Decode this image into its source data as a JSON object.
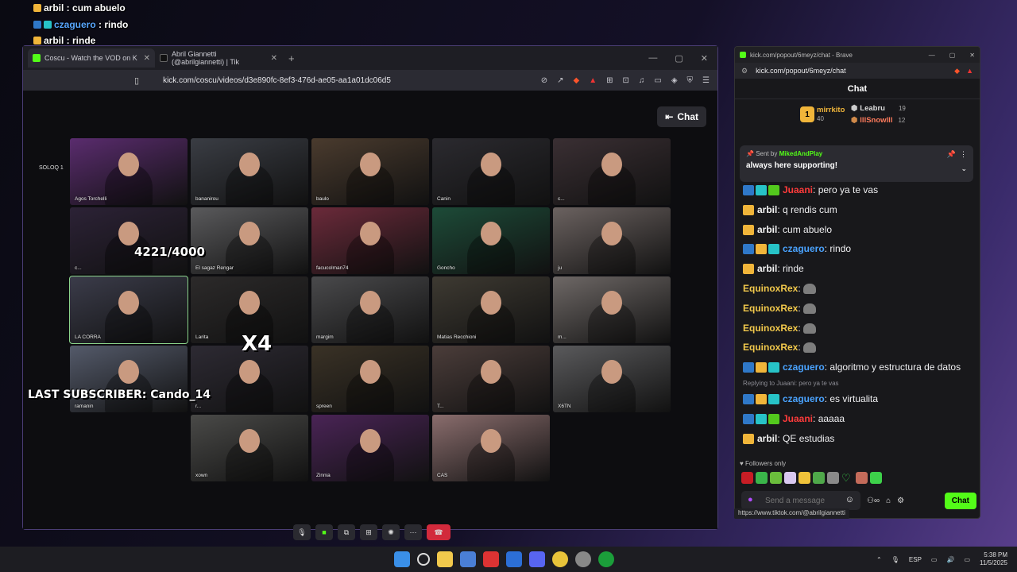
{
  "overlay_chat": [
    {
      "badges": [
        "crown"
      ],
      "name": "arbil",
      "name_color": "arbil",
      "text": "cum abuelo"
    },
    {
      "badges": [
        "mod",
        "eco"
      ],
      "name": "czaguero",
      "name_color": "cz",
      "text": "rindo"
    },
    {
      "badges": [
        "crown"
      ],
      "name": "arbil",
      "name_color": "arbil",
      "text": "rinde"
    },
    {
      "badges": [],
      "name": "EquinoxRex",
      "name_color": "eq",
      "text": "",
      "rat": true
    },
    {
      "badges": [],
      "name": "EquinoxRex",
      "name_color": "eq",
      "text": "",
      "rat": true
    },
    {
      "badges": [],
      "name": "EquinoxRex",
      "name_color": "eq",
      "text": "",
      "rat": true
    },
    {
      "badges": [],
      "name": "EquinoxRex",
      "name_color": "eq",
      "text": "",
      "rat": true
    },
    {
      "badges": [
        "mod",
        "crown",
        "eco"
      ],
      "name": "czaguero",
      "name_color": "cz",
      "text": "algoritmo y estructura de datos"
    },
    {
      "badges": [
        "mod",
        "eco"
      ],
      "name": "czaguero",
      "name_color": "cz",
      "text": "es virtualita"
    },
    {
      "badges": [
        "mod",
        "eco",
        "red"
      ],
      "name": "Juaani",
      "name_color": "ju",
      "text": "aaaaa"
    },
    {
      "badges": [
        "crown"
      ],
      "name": "arbil",
      "name_color": "arbil",
      "text": "QE estudias"
    }
  ],
  "left_browser": {
    "tabs": [
      {
        "title": "Coscu - Watch the VOD on K",
        "active": true,
        "color": "#53fc18"
      },
      {
        "title": "Abril Giannetti (@abrilgiannetti) | Tik",
        "active": false,
        "color": "#111"
      }
    ],
    "url": "kick.com/coscu/videos/d3e890fc-8ef3-476d-ae05-aa1a01dc06d5",
    "chat_button": "Chat",
    "solo_label": "SOLOQ 1",
    "goal_text": "4221/4000",
    "multiplier_text": "X4",
    "last_subscriber": "LAST SUBSCRIBER: Cando_14"
  },
  "video_tiles": [
    {
      "name": "Agos Torchelli",
      "bg": "#5a2c6e"
    },
    {
      "name": "bananirou",
      "bg": "#3a3d44"
    },
    {
      "name": "baulo",
      "bg": "#4a3b2e"
    },
    {
      "name": "Canin",
      "bg": "#2b2a2f"
    },
    {
      "name": "c...",
      "bg": "#3a2f33"
    },
    {
      "name": "c...",
      "bg": "#2c2236"
    },
    {
      "name": "El sagaz Rengar",
      "bg": "#5a5a5c"
    },
    {
      "name": "facucolman74",
      "bg": "#6b2a3a"
    },
    {
      "name": "Goncho",
      "bg": "#1d4b38"
    },
    {
      "name": "ju",
      "bg": "#6b6260"
    },
    {
      "name": "LA CORRA",
      "bg": "#3b3c4a"
    },
    {
      "name": "Larita",
      "bg": "#2c2a2a"
    },
    {
      "name": "margim",
      "bg": "#4a4a4c"
    },
    {
      "name": "Matias Recchioni",
      "bg": "#3e3a32"
    },
    {
      "name": "m...",
      "bg": "#6e6866"
    },
    {
      "name": "ramanin",
      "bg": "#545a6a"
    },
    {
      "name": "r...",
      "bg": "#2d2a33"
    },
    {
      "name": "spreen",
      "bg": "#3a3226"
    },
    {
      "name": "T...",
      "bg": "#4b3d3a"
    },
    {
      "name": "X6TN",
      "bg": "#5a5a5c"
    },
    {
      "name": "xown",
      "bg": "#4a4a48"
    },
    {
      "name": "Zinnia",
      "bg": "#4a2456"
    },
    {
      "name": "CAS",
      "bg": "#8a6d6d"
    }
  ],
  "right_window": {
    "title": "kick.com/popout/6meyz/chat - Brave",
    "url": "kick.com/popout/6meyz/chat",
    "header": "Chat",
    "leaders": {
      "first": {
        "rank": "1",
        "name": "mirrkito",
        "count": "40"
      },
      "second": {
        "name": "Leabru",
        "count": "19"
      },
      "third": {
        "name": "lllSnowlll",
        "count": "12"
      }
    },
    "pinned": {
      "sent_by_prefix": "Sent by",
      "sent_by_user": "MikedAndPlay",
      "message": "always here supporting!"
    },
    "messages": [
      {
        "badges": [
          "mod",
          "eco",
          "green"
        ],
        "name": "Juaani",
        "color": "ju",
        "text": "pero ya te vas"
      },
      {
        "badges": [
          "crown"
        ],
        "name": "arbil",
        "color": "arbil",
        "text": "q rendis cum"
      },
      {
        "badges": [
          "crown"
        ],
        "name": "arbil",
        "color": "arbil",
        "text": "cum abuelo"
      },
      {
        "badges": [
          "mod",
          "crown",
          "eco"
        ],
        "name": "czaguero",
        "color": "cz",
        "text": "rindo"
      },
      {
        "badges": [
          "crown"
        ],
        "name": "arbil",
        "color": "arbil",
        "text": "rinde"
      },
      {
        "badges": [],
        "name": "EquinoxRex",
        "color": "eq",
        "text": "",
        "rat": true
      },
      {
        "badges": [],
        "name": "EquinoxRex",
        "color": "eq",
        "text": "",
        "rat": true
      },
      {
        "badges": [],
        "name": "EquinoxRex",
        "color": "eq",
        "text": "",
        "rat": true
      },
      {
        "badges": [],
        "name": "EquinoxRex",
        "color": "eq",
        "text": "",
        "rat": true
      },
      {
        "badges": [
          "mod",
          "crown",
          "eco"
        ],
        "name": "czaguero",
        "color": "cz",
        "text": "algoritmo y estructura de datos"
      },
      {
        "reply": "Replying to Juaani: pero ya te vas",
        "badges": [
          "mod",
          "crown",
          "eco"
        ],
        "name": "czaguero",
        "color": "cz",
        "text": "es virtualita"
      },
      {
        "badges": [
          "mod",
          "eco",
          "green"
        ],
        "name": "Juaani",
        "color": "ju",
        "text": "aaaaa"
      },
      {
        "badges": [
          "crown"
        ],
        "name": "arbil",
        "color": "arbil",
        "text": "QE estudias"
      }
    ],
    "followers_only": "Followers only",
    "input_placeholder": "Send a message",
    "send_button": "Chat",
    "status_url": "https://www.tiktok.com/@abrilgiannetti"
  },
  "taskbar": {
    "language": "ESP",
    "time": "5:38 PM",
    "date": "11/5/2025"
  }
}
